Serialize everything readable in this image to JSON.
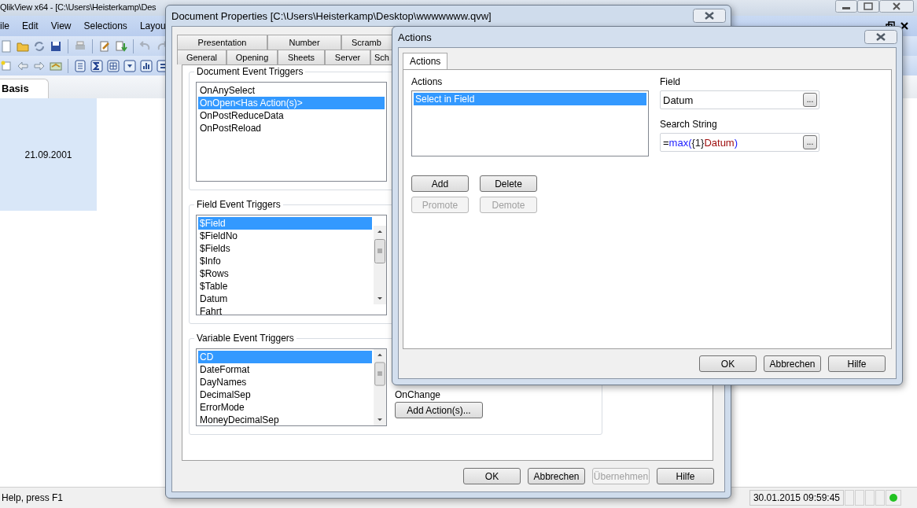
{
  "app": {
    "title": "QlikView x64 - [C:\\Users\\Heisterkamp\\Des",
    "menu": [
      "ile",
      "Edit",
      "View",
      "Selections",
      "Layou"
    ],
    "sheet_tabs": [
      {
        "label": "Basis",
        "selected": true
      }
    ],
    "sheet": {
      "value": "21.09.2001"
    },
    "status_bar": {
      "help": "Help, press F1",
      "datetime": "30.01.2015 09:59:45",
      "online": true
    }
  },
  "document_properties": {
    "title": "Document Properties [C:\\Users\\Heisterkamp\\Desktop\\wwwwwww.qvw]",
    "tab_rows": [
      [
        {
          "label": "Presentation",
          "selected": false
        },
        {
          "label": "Number",
          "selected": false
        },
        {
          "label": "Scramb",
          "selected": false
        }
      ],
      [
        {
          "label": "General",
          "selected": false
        },
        {
          "label": "Opening",
          "selected": false
        },
        {
          "label": "Sheets",
          "selected": false
        },
        {
          "label": "Server",
          "selected": false
        },
        {
          "label": "Sch",
          "selected": false
        }
      ]
    ],
    "groups": [
      {
        "title": "Document Event Triggers",
        "kind": "plain",
        "items": [
          {
            "label": "OnAnySelect",
            "selected": false
          },
          {
            "label": "OnOpen<Has Action(s)>",
            "selected": true
          },
          {
            "label": "OnPostReduceData",
            "selected": false
          },
          {
            "label": "OnPostReload",
            "selected": false
          }
        ]
      },
      {
        "title": "Field Event Triggers",
        "kind": "scrolling",
        "items": [
          {
            "label": "$Field",
            "selected": true
          },
          {
            "label": "$FieldNo",
            "selected": false
          },
          {
            "label": "$Fields",
            "selected": false
          },
          {
            "label": "$Info",
            "selected": false
          },
          {
            "label": "$Rows",
            "selected": false
          },
          {
            "label": "$Table",
            "selected": false
          },
          {
            "label": "Datum",
            "selected": false
          },
          {
            "label": "Fahrt",
            "selected": false
          }
        ]
      },
      {
        "title": "Variable Event Triggers",
        "kind": "scrolling",
        "items": [
          {
            "label": "CD",
            "selected": true
          },
          {
            "label": "DateFormat",
            "selected": false
          },
          {
            "label": "DayNames",
            "selected": false
          },
          {
            "label": "DecimalSep",
            "selected": false
          },
          {
            "label": "ErrorMode",
            "selected": false
          },
          {
            "label": "MoneyDecimalSep",
            "selected": false
          }
        ],
        "on_change": {
          "label": "OnChange",
          "button": "Add Action(s)..."
        }
      }
    ],
    "buttons": [
      {
        "label": "OK",
        "disabled": false
      },
      {
        "label": "Abbrechen",
        "disabled": false
      },
      {
        "label": "Übernehmen",
        "disabled": true
      },
      {
        "label": "Hilfe",
        "disabled": false
      }
    ]
  },
  "actions_dialog": {
    "title": "Actions",
    "tabs": [
      {
        "label": "Actions",
        "selected": true
      }
    ],
    "list_label": "Actions",
    "actions": [
      {
        "label": "Select in Field",
        "selected": true
      }
    ],
    "field": {
      "label": "Field",
      "value": "Datum",
      "button": "..."
    },
    "search_string": {
      "label": "Search String",
      "segments": [
        {
          "text": "=",
          "kind": "operator"
        },
        {
          "text": "max(",
          "kind": "function"
        },
        {
          "text": "{1}",
          "kind": "literal"
        },
        {
          "text": "Datum",
          "kind": "field"
        },
        {
          "text": ")",
          "kind": "function"
        }
      ],
      "button": "..."
    },
    "list_buttons": [
      {
        "label": "Add",
        "disabled": false
      },
      {
        "label": "Delete",
        "disabled": false
      },
      {
        "label": "Promote",
        "disabled": true
      },
      {
        "label": "Demote",
        "disabled": true
      }
    ],
    "buttons": [
      {
        "label": "OK",
        "disabled": false
      },
      {
        "label": "Abbrechen",
        "disabled": false
      },
      {
        "label": "Hilfe",
        "disabled": false
      }
    ]
  }
}
